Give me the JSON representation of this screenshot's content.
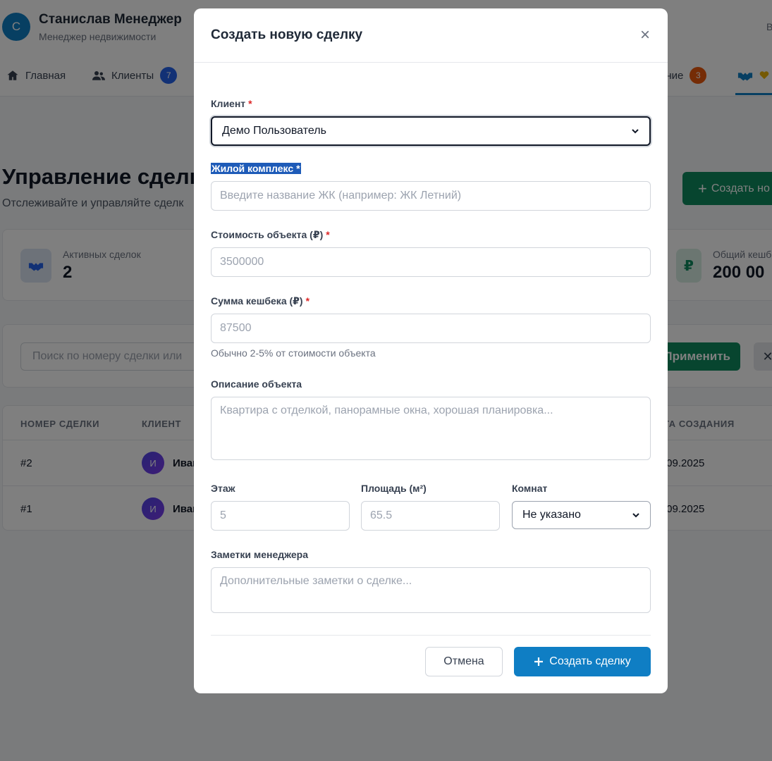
{
  "header": {
    "avatar_letter": "С",
    "user_name": "Станислав Менеджер",
    "user_role": "Менеджер недвижимости",
    "right_letter": "В"
  },
  "nav": {
    "items": [
      {
        "label": "Главная",
        "icon": "home-icon"
      },
      {
        "label": "Клиенты",
        "icon": "users-icon",
        "badge": "7"
      },
      {
        "label": "ение",
        "icon": "",
        "badge": "3"
      },
      {
        "label": "",
        "icon": "deals-icon"
      }
    ]
  },
  "page": {
    "title": "Управление сделк",
    "subtitle": "Отслеживайте и управляйте сделк",
    "create_button": "Создать но"
  },
  "stats": [
    {
      "label": "Активных сделок",
      "value": "2",
      "icon": "handshake-icon"
    },
    {
      "label": "Общий кешб",
      "value": "200 00",
      "icon": "ruble-icon"
    }
  ],
  "filters": {
    "search_placeholder": "Поиск по номеру сделки или",
    "apply_label": "Применить",
    "clear_label": "✕"
  },
  "table": {
    "columns": [
      "НОМЕР СДЕЛКИ",
      "КЛИЕНТ",
      "ТА СОЗДАНИЯ"
    ],
    "rows": [
      {
        "number": "#2",
        "client_initial": "И",
        "client_name": "Иван",
        "date": ".09.2025"
      },
      {
        "number": "#1",
        "client_initial": "И",
        "client_name": "Иван",
        "date": ".09.2025"
      }
    ]
  },
  "modal": {
    "title": "Создать новую сделку",
    "close_label": "×",
    "client": {
      "label": "Клиент",
      "required": "*",
      "value": "Демо Пользователь"
    },
    "complex": {
      "label": "Жилой комплекс",
      "required": "*",
      "placeholder": "Введите название ЖК (например: ЖК Летний)"
    },
    "price": {
      "label": "Стоимость объекта (₽)",
      "required": "*",
      "placeholder": "3500000"
    },
    "cashback": {
      "label": "Сумма кешбека (₽)",
      "required": "*",
      "placeholder": "87500",
      "hint": "Обычно 2-5% от стоимости объекта"
    },
    "description": {
      "label": "Описание объекта",
      "placeholder": "Квартира с отделкой, панорамные окна, хорошая планировка..."
    },
    "floor": {
      "label": "Этаж",
      "placeholder": "5"
    },
    "area": {
      "label": "Площадь (м²)",
      "placeholder": "65.5"
    },
    "rooms": {
      "label": "Комнат",
      "value": "Не указано"
    },
    "notes": {
      "label": "Заметки менеджера",
      "placeholder": "Дополнительные заметки о сделке..."
    },
    "cancel_label": "Отмена",
    "submit_label": "Создать сделку"
  },
  "colors": {
    "primary": "#0f7ec4",
    "success": "#0f8a5f",
    "required": "#dc2626",
    "selection": "#1e5bb8"
  }
}
